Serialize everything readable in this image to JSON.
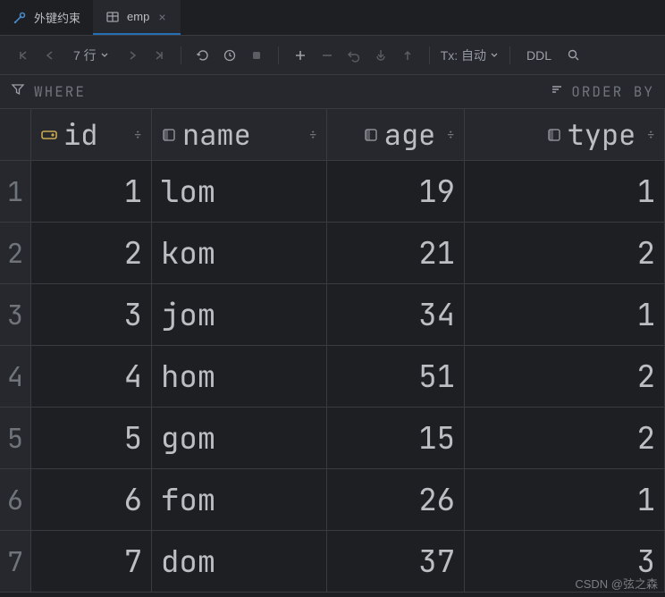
{
  "tabs": [
    {
      "label": "外键约束"
    },
    {
      "label": "emp",
      "active": true
    }
  ],
  "toolbar": {
    "rowcount_label": "7 行",
    "tx_label": "Tx: 自动",
    "ddl_label": "DDL"
  },
  "filter": {
    "where": "WHERE",
    "orderby": "ORDER BY"
  },
  "columns": [
    {
      "name": "id"
    },
    {
      "name": "name"
    },
    {
      "name": "age"
    },
    {
      "name": "type"
    }
  ],
  "rows": [
    {
      "n": "1",
      "id": "1",
      "name": "lom",
      "age": "19",
      "type": "1"
    },
    {
      "n": "2",
      "id": "2",
      "name": "kom",
      "age": "21",
      "type": "2"
    },
    {
      "n": "3",
      "id": "3",
      "name": "jom",
      "age": "34",
      "type": "1"
    },
    {
      "n": "4",
      "id": "4",
      "name": "hom",
      "age": "51",
      "type": "2"
    },
    {
      "n": "5",
      "id": "5",
      "name": "gom",
      "age": "15",
      "type": "2"
    },
    {
      "n": "6",
      "id": "6",
      "name": "fom",
      "age": "26",
      "type": "1"
    },
    {
      "n": "7",
      "id": "7",
      "name": "dom",
      "age": "37",
      "type": "3"
    }
  ],
  "watermark": "CSDN @弦之森"
}
